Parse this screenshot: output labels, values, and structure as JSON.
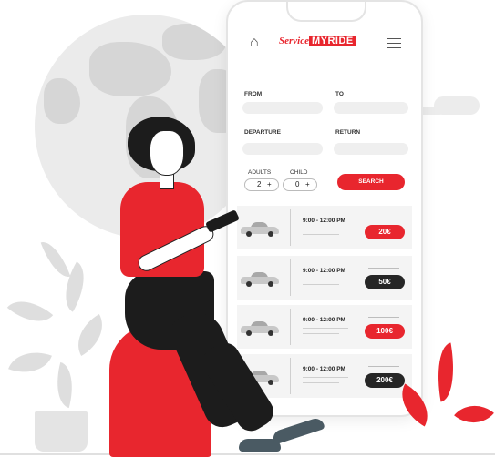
{
  "header": {
    "home_icon": "home-icon",
    "logo_script": "Service",
    "logo_box": "MYRIDE",
    "menu_icon": "hamburger-menu-icon"
  },
  "form": {
    "from_label": "FROM",
    "to_label": "TO",
    "departure_label": "DEPARTURE",
    "return_label": "RETURN",
    "adults_label": "ADULTS",
    "child_label": "CHILD",
    "adults_value": "2",
    "child_value": "0",
    "plus": "+",
    "search_label": "SEARCH"
  },
  "results": [
    {
      "time": "9:00 - 12:00 PM",
      "price": "20€",
      "price_style": "red"
    },
    {
      "time": "9:00 - 12:00 PM",
      "price": "50€",
      "price_style": "dark"
    },
    {
      "time": "9:00 - 12:00 PM",
      "price": "100€",
      "price_style": "red"
    },
    {
      "time": "9:00 - 12:00 PM",
      "price": "200€",
      "price_style": "dark"
    }
  ],
  "colors": {
    "accent": "#e8262e",
    "dark": "#262626",
    "card": "#f4f4f4"
  }
}
